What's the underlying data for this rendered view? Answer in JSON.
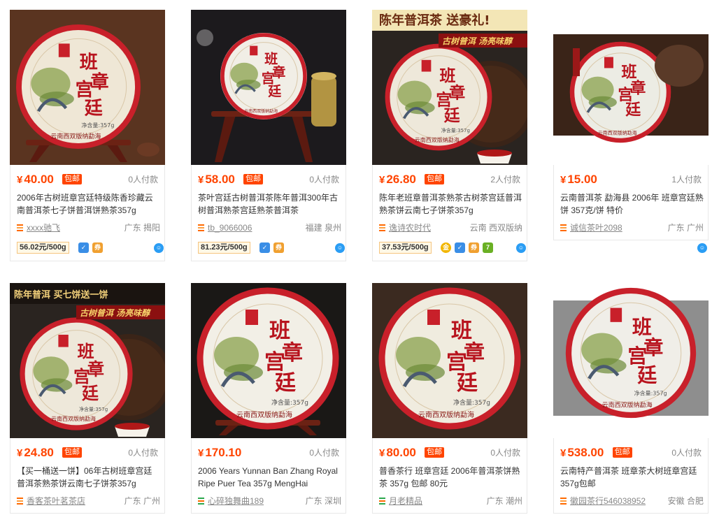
{
  "products": [
    {
      "price": "40.00",
      "baoyou": "包邮",
      "deals": "0人付款",
      "title": "2006年古树班章宫廷特级陈香珍藏云南普洱茶七子饼普洱饼熟茶357g",
      "shop": "xxxx驰飞",
      "location": "广东 揭阳",
      "unit_price": "56.02元/500g",
      "badges": [
        {
          "icon": "shield-icon",
          "glyph": "✓"
        },
        {
          "icon": "coupon-icon",
          "glyph": "券"
        }
      ],
      "image": {
        "bg": "#5a3420",
        "wrapper": "#efe7d6",
        "stand": true
      }
    },
    {
      "price": "58.00",
      "baoyou": "包邮",
      "deals": "0人付款",
      "title": "茶叶宫廷古树普洱茶陈年普洱300年古树普洱熟茶宫廷熟茶普洱茶",
      "shop": "tb_9066006",
      "location": "福建 泉州",
      "unit_price": "81.23元/500g",
      "badges": [
        {
          "icon": "shield-icon",
          "glyph": "✓"
        },
        {
          "icon": "coupon-icon",
          "glyph": "券"
        }
      ],
      "image": {
        "bg": "#1c1a1d",
        "wrapper": "#f1eee6",
        "stand": true
      }
    },
    {
      "price": "26.80",
      "baoyou": "包邮",
      "deals": "2人付款",
      "title": "陈年老班章普洱茶熟茶古树茶宫廷普洱熟茶饼云南七子饼茶357g",
      "shop": "逸诗农时代",
      "location": "云南 西双版纳",
      "unit_price": "37.53元/500g",
      "badges": [
        {
          "icon": "gold-medal-icon",
          "glyph": "金"
        },
        {
          "icon": "shield-icon",
          "glyph": "✓"
        },
        {
          "icon": "coupon-icon",
          "glyph": "券"
        },
        {
          "icon": "seven-day-return-icon",
          "glyph": "7"
        }
      ],
      "image": {
        "bg": "#2a2420",
        "wrapper": "#eee8da",
        "stand": false,
        "banner": "陈年普洱茶  送豪礼!",
        "ribbon": "古树普洱 汤亮味醇"
      }
    },
    {
      "price": "15.00",
      "baoyou": "",
      "deals": "1人付款",
      "title": "云南普洱茶 勐海县 2006年 班章宫廷熟饼 357克/饼 特价",
      "shop": "诚信茶叶2098",
      "location": "广东 广州",
      "unit_price": "",
      "badges": [],
      "image": {
        "bg": "#3a2418",
        "wrapper": "#ecece4",
        "stand": false
      }
    },
    {
      "price": "24.80",
      "baoyou": "包邮",
      "deals": "0人付款",
      "title": "【买一桶送一饼】06年古树班章宫廷普洱茶熟茶饼云南七子饼茶357g",
      "shop": "香客茶叶茗茶店",
      "location": "广东 广州",
      "unit_price": "",
      "badges": [],
      "image": {
        "bg": "#2a2420",
        "wrapper": "#eee8da",
        "stand": false,
        "banner": "陈年普洱    买七饼送一饼",
        "ribbon": "古树普洱 汤亮味醇"
      }
    },
    {
      "price": "170.10",
      "baoyou": "",
      "deals": "0人付款",
      "title": "2006 Years Yunnan Ban Zhang Royal Ripe Puer Tea 357g MengHai",
      "shop": "心碎独舞曲189",
      "location": "广东 深圳",
      "unit_price": "",
      "badges": [],
      "image": {
        "bg": "#1a1816",
        "wrapper": "#f2efe6",
        "stand": true
      }
    },
    {
      "price": "80.00",
      "baoyou": "包邮",
      "deals": "0人付款",
      "title": "普香茶行 班章宫廷 2006年普洱茶饼熟茶 357g 包邮 80元",
      "shop": "月老精品",
      "location": "广东 潮州",
      "unit_price": "",
      "badges": [],
      "image": {
        "bg": "#3b2a20",
        "wrapper": "#f0ecdf",
        "stand": false
      }
    },
    {
      "price": "538.00",
      "baoyou": "包邮",
      "deals": "0人付款",
      "title": "云南特产普洱茶 班章茶大树班章宫廷357g包邮",
      "shop": "徽园茶行546038952",
      "location": "安徽 合肥",
      "unit_price": "",
      "badges": [],
      "image": {
        "bg": "#8d8d8d",
        "wrapper": "#f0eee8",
        "stand": false
      }
    }
  ],
  "cake_label": {
    "line1": "班章",
    "line2": "宫廷",
    "net_weight": "净含量:357g",
    "maker": "云南西双版纳勐海"
  },
  "currency_symbol": "¥",
  "wangwang_glyph": "☺",
  "colors": {
    "price": "#ff4400",
    "accent": "#ff6a00",
    "cake_rim": "#c8202a"
  }
}
